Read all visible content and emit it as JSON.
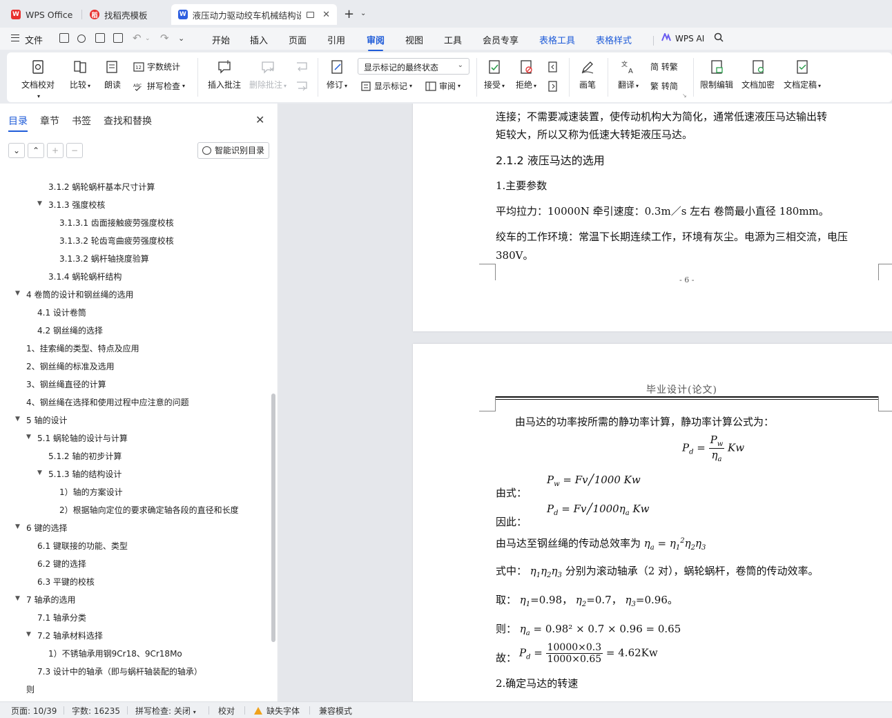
{
  "tabs": [
    {
      "label": "WPS Office",
      "active": false
    },
    {
      "label": "找稻壳模板",
      "active": false
    },
    {
      "label": "液压动力驱动绞车机械结构设计",
      "active": true
    }
  ],
  "menu": {
    "file": "文件",
    "items": [
      "开始",
      "插入",
      "页面",
      "引用",
      "审阅",
      "视图",
      "工具",
      "会员专享",
      "表格工具",
      "表格样式"
    ],
    "active": "审阅",
    "ai": "WPS AI"
  },
  "ribbon": {
    "doc_check": "文档校对",
    "compare": "比较",
    "read_aloud": "朗读",
    "word_count": "字数统计",
    "spell_check": "拼写检查",
    "insert_comment": "插入批注",
    "delete_comment": "删除批注",
    "track": "修订",
    "markup_state": "显示标记的最终状态",
    "show_markup": "显示标记",
    "review": "审阅",
    "accept": "接受",
    "reject": "拒绝",
    "pen": "画笔",
    "translate": "翻译",
    "to_traditional": "简 转繁",
    "to_simplified": "繁 转简",
    "restrict_edit": "限制编辑",
    "encrypt": "文档加密",
    "finalize": "文档定稿"
  },
  "nav": {
    "tabs": [
      "目录",
      "章节",
      "书签",
      "查找和替换"
    ],
    "smart_toc": "智能识别目录",
    "toc": [
      {
        "text": "3.1.2 蜗轮蜗杆基本尺寸计算",
        "level": 3,
        "arrow": false
      },
      {
        "text": "3.1.3 强度校核",
        "level": 3,
        "arrow": true
      },
      {
        "text": "3.1.3.1 齿面接触疲劳强度校核",
        "level": 4,
        "arrow": false
      },
      {
        "text": "3.1.3.2 轮齿弯曲疲劳强度校核",
        "level": 4,
        "arrow": false
      },
      {
        "text": "3.1.3.2 蜗杆轴挠度验算",
        "level": 4,
        "arrow": false
      },
      {
        "text": "3.1.4 蜗轮蜗杆结构",
        "level": 3,
        "arrow": false
      },
      {
        "text": "4  卷筒的设计和钢丝绳的选用",
        "level": 1,
        "arrow": true
      },
      {
        "text": "4.1 设计卷筒",
        "level": 2,
        "arrow": false
      },
      {
        "text": "4.2 钢丝绳的选择",
        "level": 2,
        "arrow": false
      },
      {
        "text": "1、挂索绳的类型、特点及应用",
        "level": 1,
        "arrow": false
      },
      {
        "text": "2、钢丝绳的标准及选用",
        "level": 1,
        "arrow": false
      },
      {
        "text": "3、钢丝绳直径的计算",
        "level": 1,
        "arrow": false
      },
      {
        "text": "4、钢丝绳在选择和使用过程中应注意的问题",
        "level": 1,
        "arrow": false
      },
      {
        "text": "5  轴的设计",
        "level": 1,
        "arrow": true
      },
      {
        "text": "5.1 蜗轮轴的设计与计算",
        "level": 2,
        "arrow": true
      },
      {
        "text": "5.1.2 轴的初步计算",
        "level": 3,
        "arrow": false
      },
      {
        "text": "5.1.3 轴的结构设计",
        "level": 3,
        "arrow": true
      },
      {
        "text": "1）轴的方案设计",
        "level": 4,
        "arrow": false
      },
      {
        "text": "2）根据轴向定位的要求确定轴各段的直径和长度",
        "level": 4,
        "arrow": false
      },
      {
        "text": "6  键的选择",
        "level": 1,
        "arrow": true
      },
      {
        "text": "6.1 键联接的功能、类型",
        "level": 2,
        "arrow": false
      },
      {
        "text": "6.2 键的选择",
        "level": 2,
        "arrow": false
      },
      {
        "text": "6.3 平键的校核",
        "level": 2,
        "arrow": false
      },
      {
        "text": "7  轴承的选用",
        "level": 1,
        "arrow": true
      },
      {
        "text": "7.1 轴承分类",
        "level": 2,
        "arrow": false
      },
      {
        "text": "7.2 轴承材料选择",
        "level": 2,
        "arrow": true
      },
      {
        "text": "1）不锈轴承用钢9Cr18、9Cr18Mo",
        "level": 3,
        "arrow": false
      },
      {
        "text": "7.3 设计中的轴承（即与蜗杆轴装配的轴承）",
        "level": 2,
        "arrow": false
      },
      {
        "text": "则",
        "level": 0,
        "arrow": false
      }
    ]
  },
  "page1": {
    "line1": "连接；不需要减速装置，使传动机构大为简化，通常低速液压马达输出转",
    "line2": "矩较大，所以又称为低速大转矩液压马达。",
    "heading": "2.1.2 液压马达的选用",
    "sub1": "1.主要参数",
    "params": "平均拉力：10000N    牵引速度：0.3m／s 左右   卷筒最小直径 180mm。",
    "env1": "绞车的工作环境：常温下长期连续工作，环境有灰尘。电源为三相交流，电压",
    "env2": "380V。",
    "page_num": "- 6 -"
  },
  "page2": {
    "header": "毕业设计(论文)",
    "intro": "由马达的功率按所需的静功率计算，静功率计算公式为：",
    "by_formula": "由式：",
    "therefore": "因此：",
    "efficiency": "由马达至钢丝绳的传动总效率为",
    "where": "式中：",
    "where_desc": "分别为滚动轴承（2 对），蜗轮蜗杆，卷筒的传动效率。",
    "take": "取：",
    "take_vals": [
      "=0.98，",
      "=0.7，",
      "=0.96。"
    ],
    "then": "则：",
    "so": "故：",
    "step2": "2.确定马达的转速",
    "eq_unit": "Kw",
    "eq_1000": "1000",
    "eq_then": "= 0.98² × 0.7 × 0.96 = 0.65",
    "eq_num": "10000×0.3",
    "eq_den": "1000×0.65",
    "eq_result": "= 4.62Kw"
  },
  "status": {
    "page": "页面: 10/39",
    "words": "字数: 16235",
    "spell": "拼写检查: 关闭",
    "proof": "校对",
    "missing_font": "缺失字体",
    "compat": "兼容模式"
  }
}
